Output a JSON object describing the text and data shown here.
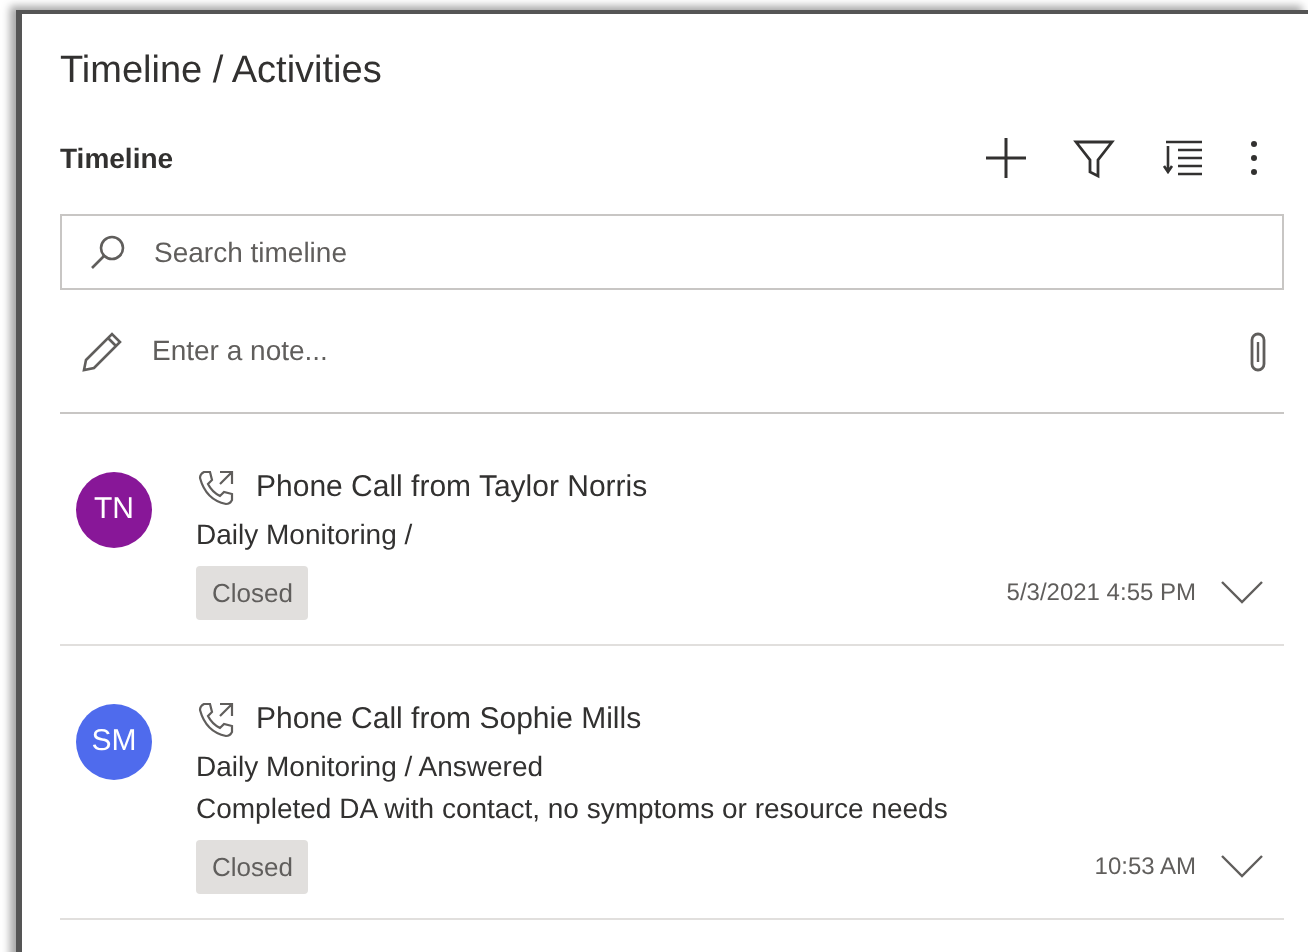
{
  "panel": {
    "title": "Timeline / Activities"
  },
  "timeline": {
    "label": "Timeline"
  },
  "search": {
    "placeholder": "Search timeline"
  },
  "note": {
    "placeholder": "Enter a note..."
  },
  "activities": [
    {
      "initials": "TN",
      "color": "#881798",
      "title": "Phone Call from Taylor Norris",
      "lines": [
        "Daily Monitoring /"
      ],
      "status": "Closed",
      "time": "5/3/2021 4:55 PM"
    },
    {
      "initials": "SM",
      "color": "#4f6bed",
      "title": "Phone Call from Sophie Mills",
      "lines": [
        "Daily Monitoring / Answered",
        "Completed DA with contact, no symptoms or resource needs"
      ],
      "status": "Closed",
      "time": "10:53 AM"
    }
  ]
}
